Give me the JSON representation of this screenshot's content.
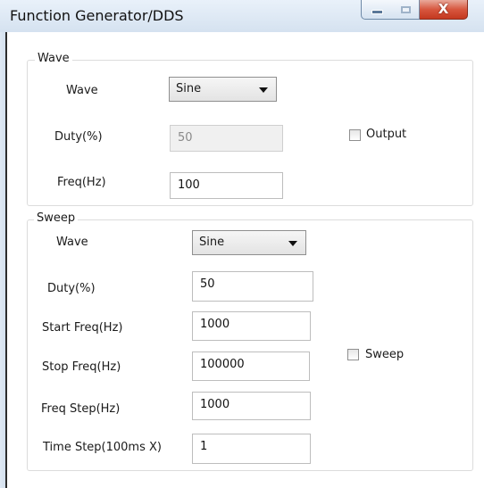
{
  "window": {
    "title": "Function Generator/DDS",
    "controls": {
      "minimize": "minimize",
      "maximize": "maximize",
      "close": "X"
    }
  },
  "wave_group": {
    "legend": "Wave",
    "wave_label": "Wave",
    "wave_value": "Sine",
    "duty_label": "Duty(%)",
    "duty_value": "50",
    "freq_label": "Freq(Hz)",
    "freq_value": "100",
    "output_label": "Output"
  },
  "sweep_group": {
    "legend": "Sweep",
    "wave_label": "Wave",
    "wave_value": "Sine",
    "duty_label": "Duty(%)",
    "duty_value": "50",
    "start_label": "Start Freq(Hz)",
    "start_value": "1000",
    "stop_label": "Stop Freq(Hz)",
    "stop_value": "100000",
    "step_label": "Freq Step(Hz)",
    "step_value": "1000",
    "time_label": "Time Step(100ms X)",
    "time_value": "1",
    "sweep_label": "Sweep"
  }
}
